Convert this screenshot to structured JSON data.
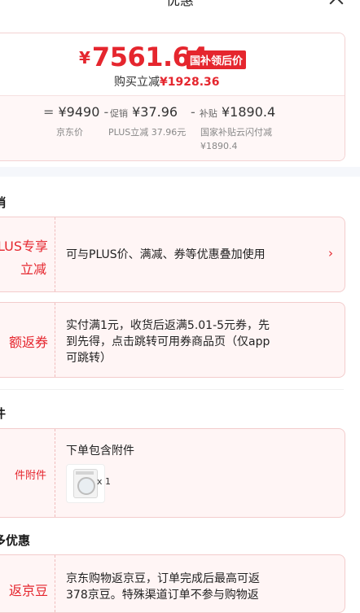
{
  "header": {
    "title": "优惠"
  },
  "price": {
    "currency": "¥",
    "final": "7561.64",
    "badge": "国补领后价",
    "buy_prefix": "购买立减",
    "buy_amount": "¥1928.36"
  },
  "calc": {
    "eq": "=",
    "base_price": "¥9490",
    "base_label": "京东价",
    "minus1": "-",
    "promo_tag": "促销",
    "promo_price": "¥37.96",
    "promo_label": "PLUS立减 37.96元",
    "minus2": "-",
    "subsidy_tag": "补贴",
    "subsidy_price": "¥1890.4",
    "subsidy_label_1": "国家补贴云闪付减",
    "subsidy_label_2": "¥1890.4"
  },
  "sections": {
    "promo_title": "销",
    "attach_title": "件",
    "more_title": "多优惠"
  },
  "promos": {
    "plus": {
      "line1": "LUS专享",
      "line2": "立减",
      "desc": "可与PLUS价、满减、券等优惠叠加使用",
      "chevron": "›"
    },
    "coupon": {
      "label": "额返券",
      "desc1": "实付满1元，收货后返满5.01-5元券，先",
      "desc2": "到先得，点击跳转可用券商品页（仅app",
      "desc3": "可跳转）"
    },
    "attach": {
      "label": "件附件",
      "desc": "下单包含附件",
      "qty": "x 1"
    },
    "jd": {
      "label": "返京豆",
      "desc1": "京东购物返京豆，订单完成后最高可返",
      "desc2": "378京豆。特殊渠道订单不参与购物返"
    }
  }
}
